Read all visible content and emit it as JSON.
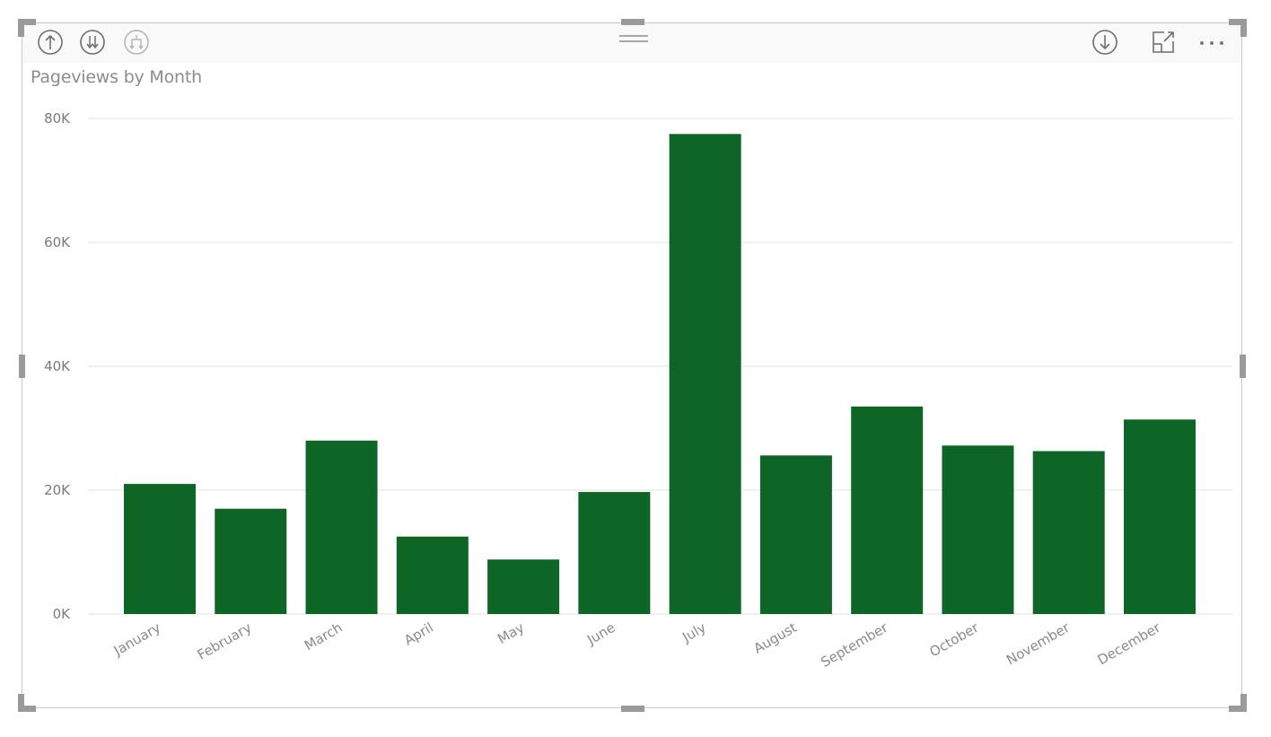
{
  "visual": {
    "title": "Pageviews by Month",
    "header_icons": {
      "drill_up": "arrow-up-circle-icon",
      "drill_down_all": "double-arrow-down-circle-icon",
      "expand_hierarchy": "fork-down-circle-icon",
      "drill_mode": "arrow-down-circle-icon",
      "focus_mode": "focus-mode-icon",
      "more_options": "more-options-icon",
      "drag_grip": "drag-grip-icon"
    }
  },
  "colors": {
    "bar": "#0e6626",
    "grid": "#ececec",
    "axis_text": "#7a7a7a",
    "title": "#8c8c8c",
    "frame": "#c8c8c8",
    "handle": "#9a9a9a"
  },
  "chart_data": {
    "type": "bar",
    "title": "Pageviews by Month",
    "xlabel": "",
    "ylabel": "",
    "categories": [
      "January",
      "February",
      "March",
      "April",
      "May",
      "June",
      "July",
      "August",
      "September",
      "October",
      "November",
      "December"
    ],
    "values": [
      21000,
      17000,
      28000,
      12500,
      8800,
      19700,
      77500,
      25600,
      33500,
      27200,
      26300,
      31400
    ],
    "ylim": [
      0,
      80000
    ],
    "yticks": [
      0,
      20000,
      40000,
      60000,
      80000
    ],
    "ytick_labels": [
      "0K",
      "20K",
      "40K",
      "60K",
      "80K"
    ],
    "grid": true,
    "legend": "none",
    "x_label_rotation": "diagonal"
  }
}
